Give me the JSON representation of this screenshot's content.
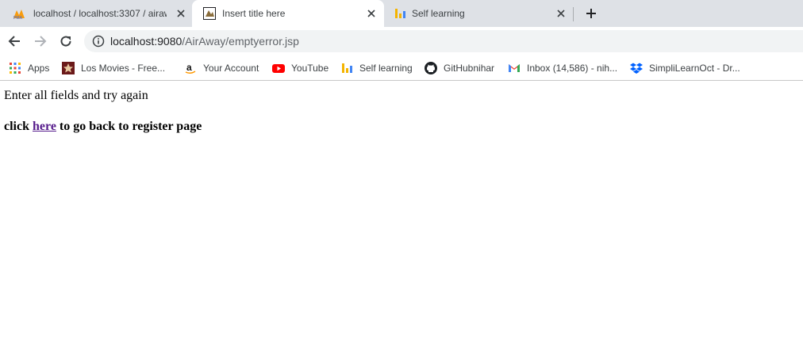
{
  "tabs": [
    {
      "title": "localhost / localhost:3307 / airaw",
      "icon": "phpmyadmin-icon"
    },
    {
      "title": "Insert title here",
      "icon": "page-icon"
    },
    {
      "title": "Self learning",
      "icon": "bars-icon"
    }
  ],
  "address_bar": {
    "host": "localhost:9080",
    "path": "/AirAway/emptyerror.jsp"
  },
  "bookmarks": [
    {
      "label": "Apps",
      "icon": "apps-grid-icon"
    },
    {
      "label": "Los Movies - Free...",
      "icon": "star-icon"
    },
    {
      "label": "Your Account",
      "icon": "amazon-icon"
    },
    {
      "label": "YouTube",
      "icon": "youtube-icon"
    },
    {
      "label": "Self learning",
      "icon": "bars-icon"
    },
    {
      "label": "GitHubnihar",
      "icon": "github-icon"
    },
    {
      "label": "Inbox (14,586) - nih...",
      "icon": "gmail-icon"
    },
    {
      "label": "SimpliLearnOct - Dr...",
      "icon": "dropbox-icon"
    }
  ],
  "page": {
    "message": "Enter all fields and try again",
    "back_prefix": "click ",
    "back_link": "here",
    "back_suffix": " to go back to register page"
  },
  "colors": {
    "tabstrip_bg": "#dee1e6",
    "omnibox_bg": "#f1f3f4",
    "visited_link": "#551a8b"
  }
}
